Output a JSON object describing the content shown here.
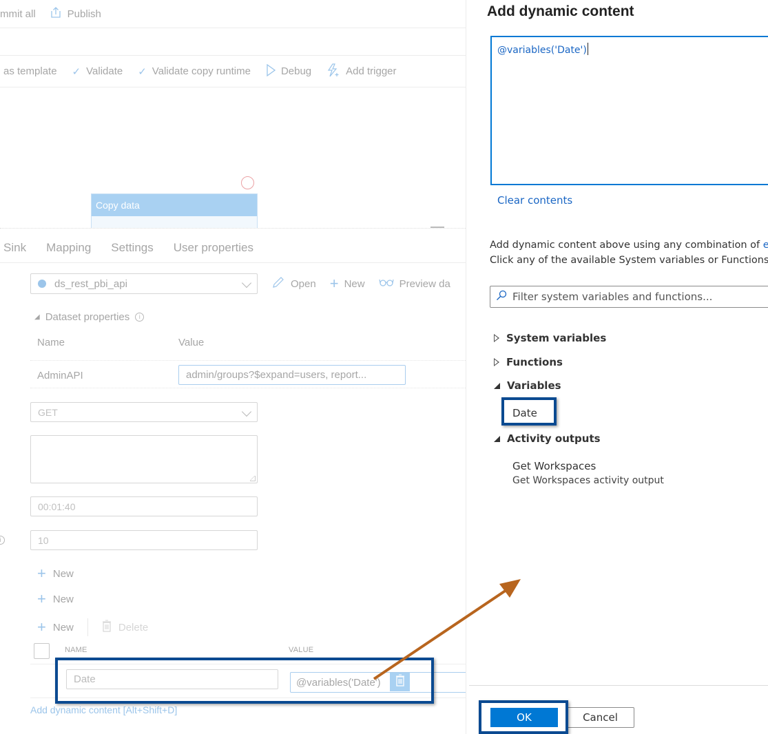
{
  "top_toolbar": {
    "commit_all": "mmit all",
    "publish": "Publish"
  },
  "pipeline_toolbar": {
    "save_as_template": "as template",
    "validate": "Validate",
    "validate_copy_runtime": "Validate copy runtime",
    "debug": "Debug",
    "add_trigger": "Add trigger"
  },
  "canvas": {
    "activity_title": "Copy data"
  },
  "tabs": [
    "Sink",
    "Mapping",
    "Settings",
    "User properties"
  ],
  "dataset": {
    "selected": "ds_rest_pbi_api",
    "open": "Open",
    "new": "New",
    "preview": "Preview da"
  },
  "dataset_properties": {
    "title": "Dataset properties",
    "col_name": "Name",
    "col_value": "Value",
    "rows": [
      {
        "name": "AdminAPI",
        "value": "admin/groups?$expand=users, report..."
      }
    ]
  },
  "request": {
    "method": "GET",
    "body": "",
    "timeout": "00:01:40",
    "interval": "10"
  },
  "new_buttons": [
    "New",
    "New",
    "New"
  ],
  "delete_label": "Delete",
  "additional_headers": {
    "col_name": "NAME",
    "col_value": "VALUE",
    "rows": [
      {
        "name_placeholder": "Date",
        "value": "@variables('Date')"
      }
    ]
  },
  "add_dynamic_link": "Add dynamic content [Alt+Shift+D]",
  "panel": {
    "title": "Add dynamic content",
    "expression": "@variables('Date')",
    "clear": "Clear contents",
    "help_line1_prefix": "Add dynamic content above using any combination of ",
    "help_line1_link": "ex",
    "help_line2": "Click any of the available System variables or Functions b",
    "filter_placeholder": "Filter system variables and functions...",
    "tree": [
      {
        "label": "System variables",
        "expanded": false
      },
      {
        "label": "Functions",
        "expanded": false
      },
      {
        "label": "Variables",
        "expanded": true,
        "children": [
          "Date"
        ]
      },
      {
        "label": "Activity outputs",
        "expanded": true,
        "children": [
          {
            "title": "Get Workspaces",
            "subtitle": "Get Workspaces activity output"
          }
        ]
      }
    ],
    "ok": "OK",
    "cancel": "Cancel"
  },
  "colors": {
    "accent": "#0078d4",
    "highlight_box": "#0b4a91",
    "arrow": "#b8651e"
  }
}
